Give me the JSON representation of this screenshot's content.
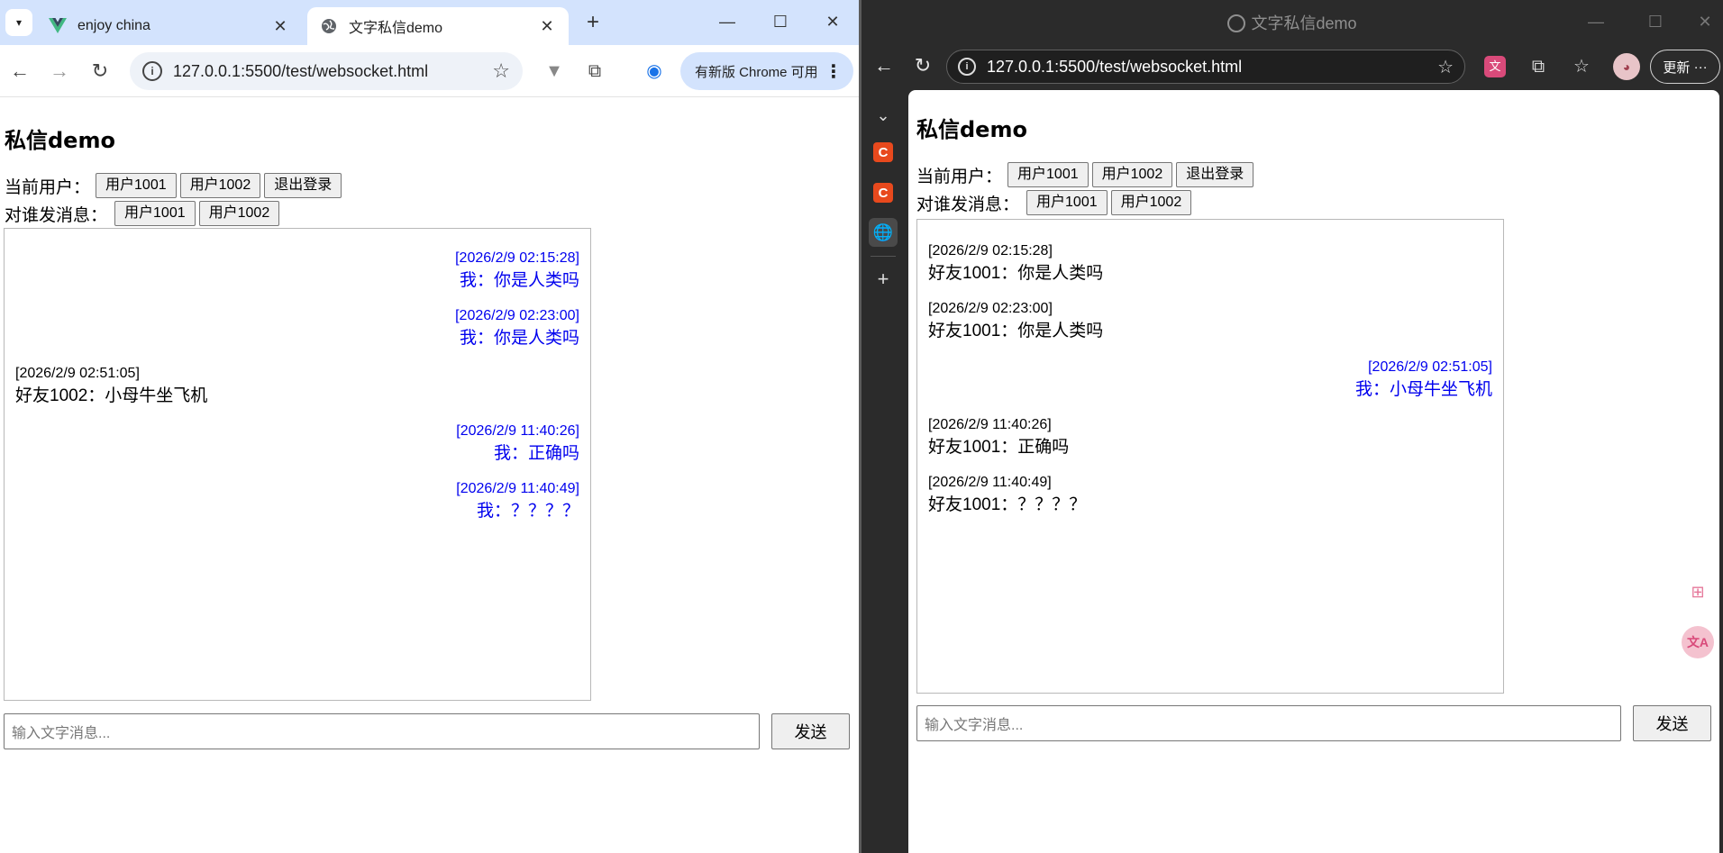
{
  "chrome": {
    "tabs": [
      {
        "title": "enjoy china",
        "favicon": "vue-logo-icon"
      },
      {
        "title": "文字私信demo",
        "favicon": "globe-icon"
      }
    ],
    "url": "127.0.0.1:5500/test/websocket.html",
    "update_label": "有新版 Chrome 可用"
  },
  "edge": {
    "window_title": "文字私信demo",
    "url": "127.0.0.1:5500/test/websocket.html",
    "update_label": "更新",
    "update_more": "···"
  },
  "left_page": {
    "title": "私信demo",
    "current_user_label": "当前用户：",
    "current_user_buttons": [
      "用户1001",
      "用户1002",
      "退出登录"
    ],
    "send_to_label": "对谁发消息：",
    "send_to_buttons": [
      "用户1001",
      "用户1002"
    ],
    "messages": [
      {
        "side": "me",
        "time": "[2026/2/9 02:15:28]",
        "text": "我：你是人类吗"
      },
      {
        "side": "me",
        "time": "[2026/2/9 02:23:00]",
        "text": "我：你是人类吗"
      },
      {
        "side": "friend",
        "time": "[2026/2/9 02:51:05]",
        "text": "好友1002：小母牛坐飞机"
      },
      {
        "side": "me",
        "time": "[2026/2/9 11:40:26]",
        "text": "我：正确吗"
      },
      {
        "side": "me",
        "time": "[2026/2/9 11:40:49]",
        "text": "我：？？？？"
      }
    ],
    "input_placeholder": "输入文字消息...",
    "send_label": "发送"
  },
  "right_page": {
    "title": "私信demo",
    "current_user_label": "当前用户：",
    "current_user_buttons": [
      "用户1001",
      "用户1002",
      "退出登录"
    ],
    "send_to_label": "对谁发消息：",
    "send_to_buttons": [
      "用户1001",
      "用户1002"
    ],
    "messages": [
      {
        "side": "friend",
        "time": "[2026/2/9 02:15:28]",
        "text": "好友1001：你是人类吗"
      },
      {
        "side": "friend",
        "time": "[2026/2/9 02:23:00]",
        "text": "好友1001：你是人类吗"
      },
      {
        "side": "me",
        "time": "[2026/2/9 02:51:05]",
        "text": "我：小母牛坐飞机"
      },
      {
        "side": "friend",
        "time": "[2026/2/9 11:40:26]",
        "text": "好友1001：正确吗"
      },
      {
        "side": "friend",
        "time": "[2026/2/9 11:40:49]",
        "text": "好友1001：？？？？"
      }
    ],
    "input_placeholder": "输入文字消息...",
    "send_label": "发送"
  },
  "colors": {
    "me_message": "#0000ee",
    "friend_message": "#000000",
    "chrome_tabbar": "#d3e3fd",
    "edge_frame": "#2b2b2b",
    "sidebar_app": "#e8491d"
  }
}
